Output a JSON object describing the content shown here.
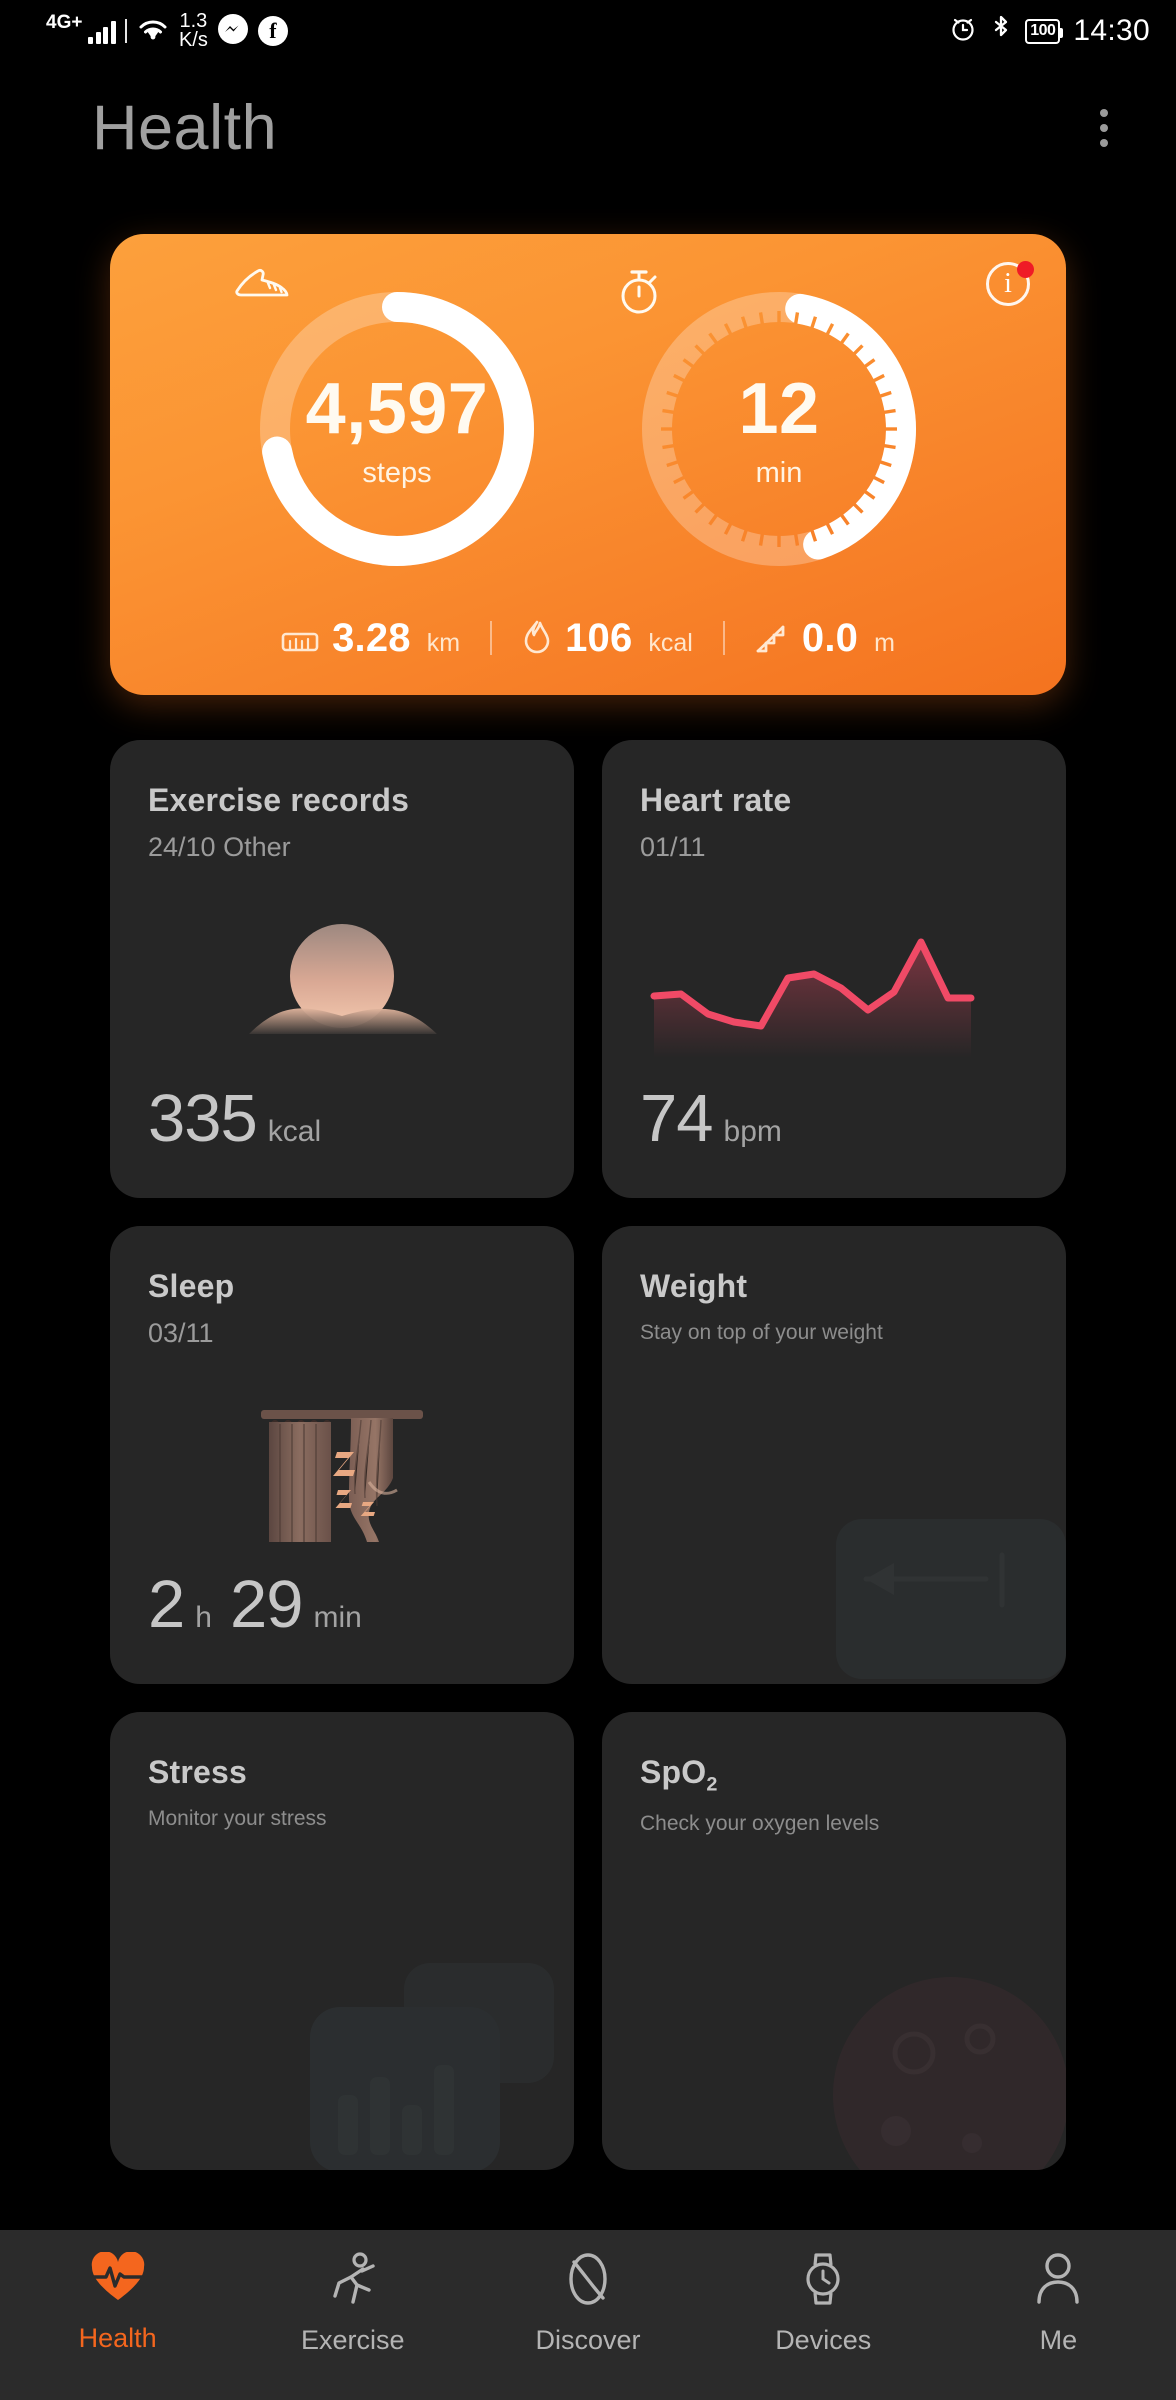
{
  "status_bar": {
    "network_type": "4G+",
    "data_speed": "1.3",
    "data_speed_unit": "K/s",
    "messenger_icon": "messenger-icon",
    "facebook_icon": "facebook-icon",
    "alarm_icon": "alarm-icon",
    "bluetooth_icon": "bluetooth-icon",
    "battery_level": "100",
    "time": "14:30"
  },
  "header": {
    "title": "Health",
    "menu_icon": "overflow-menu-icon"
  },
  "activity_card": {
    "info_icon": "info-icon",
    "has_notification_dot": true,
    "accent_color": "#f7831f",
    "rings": [
      {
        "icon": "shoe-icon",
        "value": "4,597",
        "unit": "steps",
        "progress_percent": 72
      },
      {
        "icon": "stopwatch-icon",
        "value": "12",
        "unit": "min",
        "progress_percent": 42
      }
    ],
    "stats": [
      {
        "icon": "distance-ruler-icon",
        "value": "3.28",
        "unit": "km"
      },
      {
        "icon": "flame-icon",
        "value": "106",
        "unit": "kcal"
      },
      {
        "icon": "stairs-icon",
        "value": "0.0",
        "unit": "m"
      }
    ]
  },
  "cards": [
    {
      "id": "exercise-records",
      "title": "Exercise records",
      "subtitle": "24/10 Other",
      "value": "335",
      "unit": "kcal",
      "art": "sunrise-illustration"
    },
    {
      "id": "heart-rate",
      "title": "Heart rate",
      "subtitle": "01/11",
      "value": "74",
      "unit": "bpm",
      "art": "heart-rate-line-chart",
      "line_color": "#f04a66"
    },
    {
      "id": "sleep",
      "title": "Sleep",
      "subtitle": "03/11",
      "value_hours": "2",
      "unit_hours": "h",
      "value_minutes": "29",
      "unit_minutes": "min",
      "art": "curtains-sleep-illustration"
    },
    {
      "id": "weight",
      "title": "Weight",
      "subtitle": "Stay on top of your weight",
      "art": "scale-illustration"
    },
    {
      "id": "stress",
      "title": "Stress",
      "subtitle": "Monitor your stress",
      "art": "stress-chart-illustration"
    },
    {
      "id": "spo2",
      "title": "SpO",
      "title_sub": "2",
      "subtitle": "Check your oxygen levels",
      "art": "oxygen-illustration"
    }
  ],
  "chart_data": {
    "type": "line",
    "title": "Heart rate",
    "subtitle": "01/11",
    "ylabel": "bpm",
    "latest_value": 74,
    "x": [
      0,
      1,
      2,
      3,
      4,
      5,
      6,
      7,
      8,
      9,
      10,
      11
    ],
    "values": [
      68,
      69,
      64,
      61,
      60,
      78,
      80,
      76,
      66,
      72,
      96,
      70
    ],
    "line_color": "#f04a66",
    "grid": false,
    "legend": "none"
  },
  "bottom_nav": {
    "active": "Health",
    "items": [
      {
        "label": "Health",
        "icon": "heart-pulse-icon"
      },
      {
        "label": "Exercise",
        "icon": "running-person-icon"
      },
      {
        "label": "Discover",
        "icon": "compass-icon"
      },
      {
        "label": "Devices",
        "icon": "watch-icon"
      },
      {
        "label": "Me",
        "icon": "person-icon"
      }
    ]
  }
}
